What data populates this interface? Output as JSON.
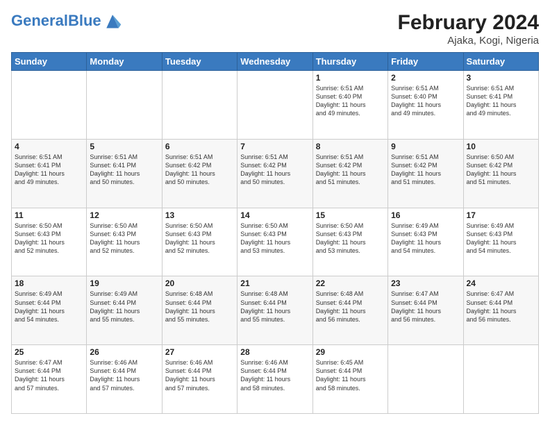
{
  "header": {
    "logo_general": "General",
    "logo_blue": "Blue",
    "month_year": "February 2024",
    "location": "Ajaka, Kogi, Nigeria"
  },
  "days_of_week": [
    "Sunday",
    "Monday",
    "Tuesday",
    "Wednesday",
    "Thursday",
    "Friday",
    "Saturday"
  ],
  "weeks": [
    [
      {
        "day": "",
        "info": ""
      },
      {
        "day": "",
        "info": ""
      },
      {
        "day": "",
        "info": ""
      },
      {
        "day": "",
        "info": ""
      },
      {
        "day": "1",
        "info": "Sunrise: 6:51 AM\nSunset: 6:40 PM\nDaylight: 11 hours\nand 49 minutes."
      },
      {
        "day": "2",
        "info": "Sunrise: 6:51 AM\nSunset: 6:40 PM\nDaylight: 11 hours\nand 49 minutes."
      },
      {
        "day": "3",
        "info": "Sunrise: 6:51 AM\nSunset: 6:41 PM\nDaylight: 11 hours\nand 49 minutes."
      }
    ],
    [
      {
        "day": "4",
        "info": "Sunrise: 6:51 AM\nSunset: 6:41 PM\nDaylight: 11 hours\nand 49 minutes."
      },
      {
        "day": "5",
        "info": "Sunrise: 6:51 AM\nSunset: 6:41 PM\nDaylight: 11 hours\nand 50 minutes."
      },
      {
        "day": "6",
        "info": "Sunrise: 6:51 AM\nSunset: 6:42 PM\nDaylight: 11 hours\nand 50 minutes."
      },
      {
        "day": "7",
        "info": "Sunrise: 6:51 AM\nSunset: 6:42 PM\nDaylight: 11 hours\nand 50 minutes."
      },
      {
        "day": "8",
        "info": "Sunrise: 6:51 AM\nSunset: 6:42 PM\nDaylight: 11 hours\nand 51 minutes."
      },
      {
        "day": "9",
        "info": "Sunrise: 6:51 AM\nSunset: 6:42 PM\nDaylight: 11 hours\nand 51 minutes."
      },
      {
        "day": "10",
        "info": "Sunrise: 6:50 AM\nSunset: 6:42 PM\nDaylight: 11 hours\nand 51 minutes."
      }
    ],
    [
      {
        "day": "11",
        "info": "Sunrise: 6:50 AM\nSunset: 6:43 PM\nDaylight: 11 hours\nand 52 minutes."
      },
      {
        "day": "12",
        "info": "Sunrise: 6:50 AM\nSunset: 6:43 PM\nDaylight: 11 hours\nand 52 minutes."
      },
      {
        "day": "13",
        "info": "Sunrise: 6:50 AM\nSunset: 6:43 PM\nDaylight: 11 hours\nand 52 minutes."
      },
      {
        "day": "14",
        "info": "Sunrise: 6:50 AM\nSunset: 6:43 PM\nDaylight: 11 hours\nand 53 minutes."
      },
      {
        "day": "15",
        "info": "Sunrise: 6:50 AM\nSunset: 6:43 PM\nDaylight: 11 hours\nand 53 minutes."
      },
      {
        "day": "16",
        "info": "Sunrise: 6:49 AM\nSunset: 6:43 PM\nDaylight: 11 hours\nand 54 minutes."
      },
      {
        "day": "17",
        "info": "Sunrise: 6:49 AM\nSunset: 6:43 PM\nDaylight: 11 hours\nand 54 minutes."
      }
    ],
    [
      {
        "day": "18",
        "info": "Sunrise: 6:49 AM\nSunset: 6:44 PM\nDaylight: 11 hours\nand 54 minutes."
      },
      {
        "day": "19",
        "info": "Sunrise: 6:49 AM\nSunset: 6:44 PM\nDaylight: 11 hours\nand 55 minutes."
      },
      {
        "day": "20",
        "info": "Sunrise: 6:48 AM\nSunset: 6:44 PM\nDaylight: 11 hours\nand 55 minutes."
      },
      {
        "day": "21",
        "info": "Sunrise: 6:48 AM\nSunset: 6:44 PM\nDaylight: 11 hours\nand 55 minutes."
      },
      {
        "day": "22",
        "info": "Sunrise: 6:48 AM\nSunset: 6:44 PM\nDaylight: 11 hours\nand 56 minutes."
      },
      {
        "day": "23",
        "info": "Sunrise: 6:47 AM\nSunset: 6:44 PM\nDaylight: 11 hours\nand 56 minutes."
      },
      {
        "day": "24",
        "info": "Sunrise: 6:47 AM\nSunset: 6:44 PM\nDaylight: 11 hours\nand 56 minutes."
      }
    ],
    [
      {
        "day": "25",
        "info": "Sunrise: 6:47 AM\nSunset: 6:44 PM\nDaylight: 11 hours\nand 57 minutes."
      },
      {
        "day": "26",
        "info": "Sunrise: 6:46 AM\nSunset: 6:44 PM\nDaylight: 11 hours\nand 57 minutes."
      },
      {
        "day": "27",
        "info": "Sunrise: 6:46 AM\nSunset: 6:44 PM\nDaylight: 11 hours\nand 57 minutes."
      },
      {
        "day": "28",
        "info": "Sunrise: 6:46 AM\nSunset: 6:44 PM\nDaylight: 11 hours\nand 58 minutes."
      },
      {
        "day": "29",
        "info": "Sunrise: 6:45 AM\nSunset: 6:44 PM\nDaylight: 11 hours\nand 58 minutes."
      },
      {
        "day": "",
        "info": ""
      },
      {
        "day": "",
        "info": ""
      }
    ]
  ]
}
